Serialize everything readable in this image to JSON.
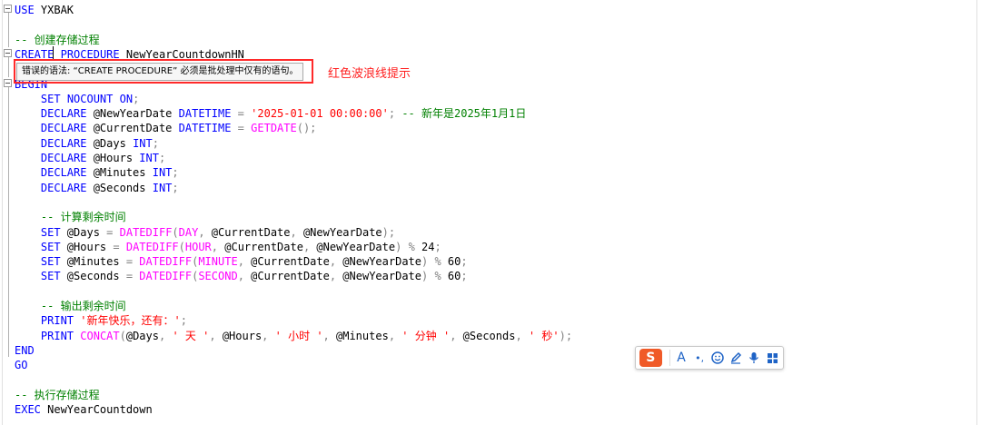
{
  "editor": {
    "lines": [
      {
        "tokens": [
          {
            "t": "USE",
            "c": "kw"
          },
          {
            "t": " YXBAK",
            "c": ""
          }
        ]
      },
      {
        "tokens": []
      },
      {
        "tokens": [
          {
            "t": "-- 创建存储过程",
            "c": "cm"
          }
        ]
      },
      {
        "tokens": [
          {
            "t": "CREATE",
            "c": "kw"
          },
          {
            "t": " ",
            "c": ""
          },
          {
            "t": "PROCEDURE",
            "c": "kw"
          },
          {
            "t": " NewYearCountdownHN",
            "c": ""
          }
        ]
      },
      {
        "tokens": []
      },
      {
        "tokens": [
          {
            "t": "BEGIN",
            "c": "kw"
          }
        ]
      },
      {
        "tokens": [
          {
            "t": "    SET",
            "c": "kw"
          },
          {
            "t": " ",
            "c": ""
          },
          {
            "t": "NOCOUNT",
            "c": "kw"
          },
          {
            "t": " ",
            "c": ""
          },
          {
            "t": "ON",
            "c": "kw"
          },
          {
            "t": ";",
            "c": "op"
          }
        ]
      },
      {
        "tokens": [
          {
            "t": "    DECLARE",
            "c": "kw"
          },
          {
            "t": " @NewYearDate ",
            "c": ""
          },
          {
            "t": "DATETIME",
            "c": "kw"
          },
          {
            "t": " ",
            "c": ""
          },
          {
            "t": "=",
            "c": "op"
          },
          {
            "t": " ",
            "c": ""
          },
          {
            "t": "'2025-01-01 00:00:00'",
            "c": "str"
          },
          {
            "t": ";",
            "c": "op"
          },
          {
            "t": " -- 新年是2025年1月1日",
            "c": "cm"
          }
        ]
      },
      {
        "tokens": [
          {
            "t": "    DECLARE",
            "c": "kw"
          },
          {
            "t": " @CurrentDate ",
            "c": ""
          },
          {
            "t": "DATETIME",
            "c": "kw"
          },
          {
            "t": " ",
            "c": ""
          },
          {
            "t": "=",
            "c": "op"
          },
          {
            "t": " ",
            "c": ""
          },
          {
            "t": "GETDATE",
            "c": "fn"
          },
          {
            "t": "();",
            "c": "op"
          }
        ]
      },
      {
        "tokens": [
          {
            "t": "    DECLARE",
            "c": "kw"
          },
          {
            "t": " @Days ",
            "c": ""
          },
          {
            "t": "INT",
            "c": "kw"
          },
          {
            "t": ";",
            "c": "op"
          }
        ]
      },
      {
        "tokens": [
          {
            "t": "    DECLARE",
            "c": "kw"
          },
          {
            "t": " @Hours ",
            "c": ""
          },
          {
            "t": "INT",
            "c": "kw"
          },
          {
            "t": ";",
            "c": "op"
          }
        ]
      },
      {
        "tokens": [
          {
            "t": "    DECLARE",
            "c": "kw"
          },
          {
            "t": " @Minutes ",
            "c": ""
          },
          {
            "t": "INT",
            "c": "kw"
          },
          {
            "t": ";",
            "c": "op"
          }
        ]
      },
      {
        "tokens": [
          {
            "t": "    DECLARE",
            "c": "kw"
          },
          {
            "t": " @Seconds ",
            "c": ""
          },
          {
            "t": "INT",
            "c": "kw"
          },
          {
            "t": ";",
            "c": "op"
          }
        ]
      },
      {
        "tokens": []
      },
      {
        "tokens": [
          {
            "t": "    -- 计算剩余时间",
            "c": "cm"
          }
        ]
      },
      {
        "tokens": [
          {
            "t": "    SET",
            "c": "kw"
          },
          {
            "t": " @Days ",
            "c": ""
          },
          {
            "t": "=",
            "c": "op"
          },
          {
            "t": " ",
            "c": ""
          },
          {
            "t": "DATEDIFF",
            "c": "fn"
          },
          {
            "t": "(",
            "c": "op"
          },
          {
            "t": "DAY",
            "c": "fn"
          },
          {
            "t": ",",
            "c": "op"
          },
          {
            "t": " @CurrentDate",
            "c": ""
          },
          {
            "t": ",",
            "c": "op"
          },
          {
            "t": " @NewYearDate",
            "c": ""
          },
          {
            "t": ");",
            "c": "op"
          }
        ]
      },
      {
        "tokens": [
          {
            "t": "    SET",
            "c": "kw"
          },
          {
            "t": " @Hours ",
            "c": ""
          },
          {
            "t": "=",
            "c": "op"
          },
          {
            "t": " ",
            "c": ""
          },
          {
            "t": "DATEDIFF",
            "c": "fn"
          },
          {
            "t": "(",
            "c": "op"
          },
          {
            "t": "HOUR",
            "c": "fn"
          },
          {
            "t": ",",
            "c": "op"
          },
          {
            "t": " @CurrentDate",
            "c": ""
          },
          {
            "t": ",",
            "c": "op"
          },
          {
            "t": " @NewYearDate",
            "c": ""
          },
          {
            "t": ")",
            "c": "op"
          },
          {
            "t": " ",
            "c": ""
          },
          {
            "t": "%",
            "c": "op"
          },
          {
            "t": " 24",
            "c": ""
          },
          {
            "t": ";",
            "c": "op"
          }
        ]
      },
      {
        "tokens": [
          {
            "t": "    SET",
            "c": "kw"
          },
          {
            "t": " @Minutes ",
            "c": ""
          },
          {
            "t": "=",
            "c": "op"
          },
          {
            "t": " ",
            "c": ""
          },
          {
            "t": "DATEDIFF",
            "c": "fn"
          },
          {
            "t": "(",
            "c": "op"
          },
          {
            "t": "MINUTE",
            "c": "fn"
          },
          {
            "t": ",",
            "c": "op"
          },
          {
            "t": " @CurrentDate",
            "c": ""
          },
          {
            "t": ",",
            "c": "op"
          },
          {
            "t": " @NewYearDate",
            "c": ""
          },
          {
            "t": ")",
            "c": "op"
          },
          {
            "t": " ",
            "c": ""
          },
          {
            "t": "%",
            "c": "op"
          },
          {
            "t": " 60",
            "c": ""
          },
          {
            "t": ";",
            "c": "op"
          }
        ]
      },
      {
        "tokens": [
          {
            "t": "    SET",
            "c": "kw"
          },
          {
            "t": " @Seconds ",
            "c": ""
          },
          {
            "t": "=",
            "c": "op"
          },
          {
            "t": " ",
            "c": ""
          },
          {
            "t": "DATEDIFF",
            "c": "fn"
          },
          {
            "t": "(",
            "c": "op"
          },
          {
            "t": "SECOND",
            "c": "fn"
          },
          {
            "t": ",",
            "c": "op"
          },
          {
            "t": " @CurrentDate",
            "c": ""
          },
          {
            "t": ",",
            "c": "op"
          },
          {
            "t": " @NewYearDate",
            "c": ""
          },
          {
            "t": ")",
            "c": "op"
          },
          {
            "t": " ",
            "c": ""
          },
          {
            "t": "%",
            "c": "op"
          },
          {
            "t": " 60",
            "c": ""
          },
          {
            "t": ";",
            "c": "op"
          }
        ]
      },
      {
        "tokens": []
      },
      {
        "tokens": [
          {
            "t": "    -- 输出剩余时间",
            "c": "cm"
          }
        ]
      },
      {
        "tokens": [
          {
            "t": "    PRINT",
            "c": "kw"
          },
          {
            "t": " ",
            "c": ""
          },
          {
            "t": "'新年快乐，还有：'",
            "c": "str"
          },
          {
            "t": ";",
            "c": "op"
          }
        ]
      },
      {
        "tokens": [
          {
            "t": "    PRINT",
            "c": "kw"
          },
          {
            "t": " ",
            "c": ""
          },
          {
            "t": "CONCAT",
            "c": "fn"
          },
          {
            "t": "(",
            "c": "op"
          },
          {
            "t": "@Days",
            "c": ""
          },
          {
            "t": ",",
            "c": "op"
          },
          {
            "t": " ",
            "c": ""
          },
          {
            "t": "' 天 '",
            "c": "str"
          },
          {
            "t": ",",
            "c": "op"
          },
          {
            "t": " @Hours",
            "c": ""
          },
          {
            "t": ",",
            "c": "op"
          },
          {
            "t": " ",
            "c": ""
          },
          {
            "t": "' 小时 '",
            "c": "str"
          },
          {
            "t": ",",
            "c": "op"
          },
          {
            "t": " @Minutes",
            "c": ""
          },
          {
            "t": ",",
            "c": "op"
          },
          {
            "t": " ",
            "c": ""
          },
          {
            "t": "' 分钟 '",
            "c": "str"
          },
          {
            "t": ",",
            "c": "op"
          },
          {
            "t": " @Seconds",
            "c": ""
          },
          {
            "t": ",",
            "c": "op"
          },
          {
            "t": " ",
            "c": ""
          },
          {
            "t": "' 秒'",
            "c": "str"
          },
          {
            "t": ");",
            "c": "op"
          }
        ]
      },
      {
        "tokens": [
          {
            "t": "END",
            "c": "kw"
          }
        ]
      },
      {
        "tokens": [
          {
            "t": "GO",
            "c": "kw"
          }
        ]
      },
      {
        "tokens": []
      },
      {
        "tokens": [
          {
            "t": "-- 执行存储过程",
            "c": "cm"
          }
        ]
      },
      {
        "tokens": [
          {
            "t": "EXEC",
            "c": "kw"
          },
          {
            "t": " NewYearCountdown",
            "c": ""
          }
        ]
      }
    ]
  },
  "tooltip": {
    "text": "错误的语法: “CREATE PROCEDURE” 必须是批处理中仅有的语句。"
  },
  "annotation": {
    "text": "红色波浪线提示"
  },
  "ime_toolbar": {
    "logo_text": "S",
    "font_button": "A",
    "punct_button": "•,",
    "colors": {
      "logo": "#f05a28",
      "icons": "#1e63c6"
    }
  },
  "colors": {
    "keyword": "#0000ff",
    "function": "#ff00ff",
    "string": "#ff0000",
    "comment": "#008000",
    "operator": "#808080",
    "error_box": "#ff2a2a"
  }
}
